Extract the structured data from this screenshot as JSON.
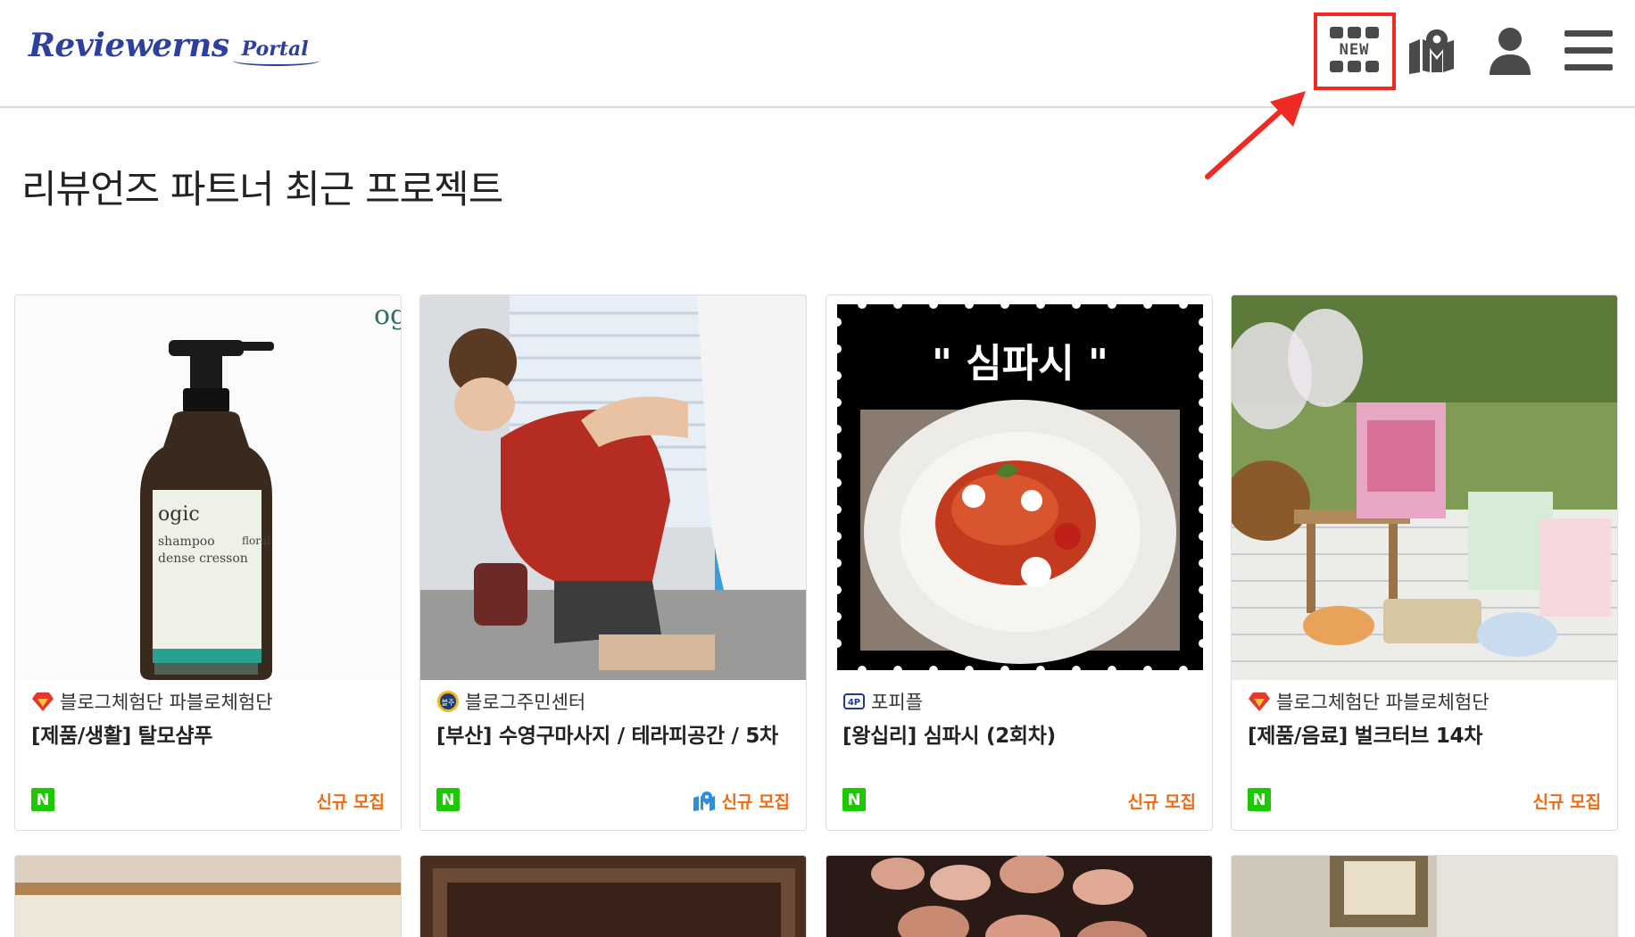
{
  "header": {
    "logo_main": "Reviewerns",
    "logo_sub": "Portal",
    "new_label": "NEW"
  },
  "page": {
    "title": "리뷰언즈 파트너 최근 프로젝트"
  },
  "cards": [
    {
      "category": "블로그체험단 파블로체험단",
      "title": "[제품/생활] 탈모샴푸",
      "badge": "N",
      "status": "신규 모집",
      "thumb_label_top": "ogic",
      "thumb_label_brand": "ogic",
      "thumb_label_line1": "shampoo",
      "thumb_label_line2": "dense cresson",
      "thumb_label_side": "floral"
    },
    {
      "category": "블로그주민센터",
      "title": "[부산] 수영구마사지 / 테라피공간 / 5차",
      "badge": "N",
      "status": "신규 모집"
    },
    {
      "category": "포피플",
      "title": "[왕십리] 심파시 (2회차)",
      "badge": "N",
      "status": "신규 모집",
      "thumb_caption": "\" 심파시 \""
    },
    {
      "category": "블로그체험단 파블로체험단",
      "title": "[제품/음료] 벌크터브 14차",
      "badge": "N",
      "status": "신규 모집"
    }
  ],
  "colors": {
    "accent_status": "#ef6a10",
    "naver_green": "#1ec800",
    "logo_blue": "#2f3f9e",
    "highlight_red": "#ee2a22"
  },
  "icons": [
    "new-grid-icon",
    "map-icon",
    "user-icon",
    "hamburger-menu-icon",
    "pointer-arrow"
  ]
}
